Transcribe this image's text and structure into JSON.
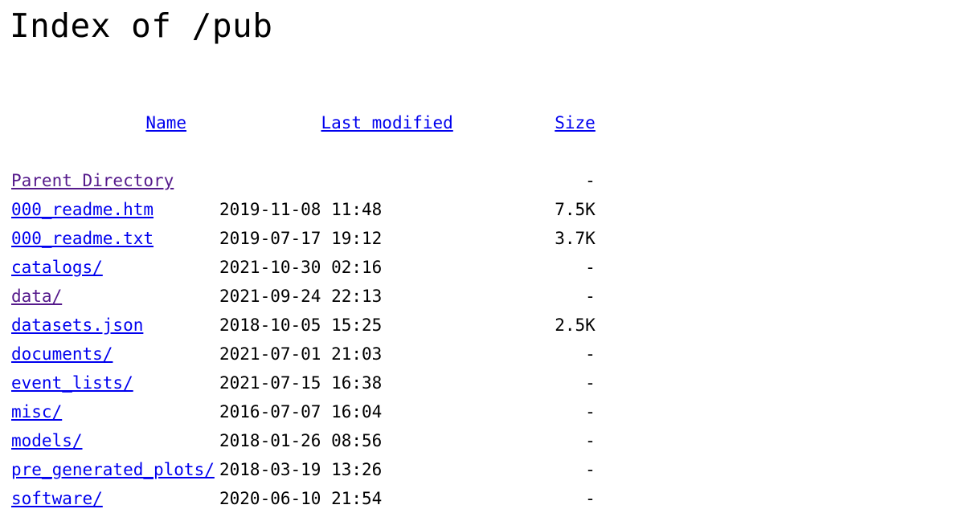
{
  "page": {
    "title": "Index of /pub",
    "directory_path": "/pub"
  },
  "colors": {
    "link": "#0000EE",
    "visited_link": "#551A8B",
    "text": "#000000",
    "background": "#FFFFFF"
  },
  "table": {
    "headers": {
      "name": "Name",
      "last_modified": "Last modified",
      "size": "Size"
    },
    "rows": [
      {
        "name": "Parent Directory",
        "last_modified": "",
        "size": "-",
        "visited": true,
        "is_directory": true
      },
      {
        "name": "000_readme.htm",
        "last_modified": "2019-11-08 11:48",
        "size": "7.5K",
        "visited": false,
        "is_directory": false
      },
      {
        "name": "000_readme.txt",
        "last_modified": "2019-07-17 19:12",
        "size": "3.7K",
        "visited": false,
        "is_directory": false
      },
      {
        "name": "catalogs/",
        "last_modified": "2021-10-30 02:16",
        "size": "-",
        "visited": false,
        "is_directory": true
      },
      {
        "name": "data/",
        "last_modified": "2021-09-24 22:13",
        "size": "-",
        "visited": true,
        "is_directory": true
      },
      {
        "name": "datasets.json",
        "last_modified": "2018-10-05 15:25",
        "size": "2.5K",
        "visited": false,
        "is_directory": false
      },
      {
        "name": "documents/",
        "last_modified": "2021-07-01 21:03",
        "size": "-",
        "visited": false,
        "is_directory": true
      },
      {
        "name": "event_lists/",
        "last_modified": "2021-07-15 16:38",
        "size": "-",
        "visited": false,
        "is_directory": true
      },
      {
        "name": "misc/",
        "last_modified": "2016-07-07 16:04",
        "size": "-",
        "visited": false,
        "is_directory": true
      },
      {
        "name": "models/",
        "last_modified": "2018-01-26 08:56",
        "size": "-",
        "visited": false,
        "is_directory": true
      },
      {
        "name": "pre_generated_plots/",
        "last_modified": "2018-03-19 13:26",
        "size": "-",
        "visited": false,
        "is_directory": true
      },
      {
        "name": "software/",
        "last_modified": "2020-06-10 21:54",
        "size": "-",
        "visited": false,
        "is_directory": true
      }
    ]
  }
}
